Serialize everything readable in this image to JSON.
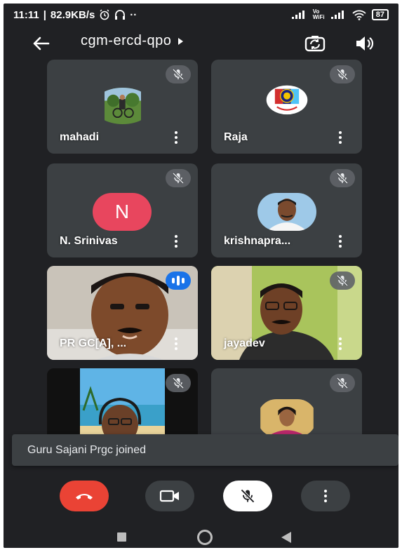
{
  "status_bar": {
    "time": "11:11",
    "speed": "82.9KB/s",
    "network_label": "Vo WiFi",
    "battery": "87"
  },
  "header": {
    "meeting_code": "cgm-ercd-qpo"
  },
  "participants": [
    {
      "name": "mahadi",
      "muted": true,
      "speaking": false
    },
    {
      "name": "Raja",
      "muted": true,
      "speaking": false
    },
    {
      "name": "N. Srinivas",
      "initial": "N",
      "avatar_color": "#e8465e",
      "muted": true,
      "speaking": false
    },
    {
      "name": "krishnapra...",
      "muted": true,
      "speaking": false
    },
    {
      "name": "PR GC[A], ...",
      "muted": false,
      "speaking": true
    },
    {
      "name": "jayadev",
      "muted": true,
      "speaking": false
    },
    {
      "name": "",
      "muted": true,
      "speaking": false
    },
    {
      "name": "",
      "muted": true,
      "speaking": false
    }
  ],
  "toast": {
    "message": "Guru Sajani Prgc joined"
  },
  "controls": {
    "end_call_color": "#ea4335"
  },
  "icons": {
    "back": "arrow-left-icon",
    "camera_switch": "camera-switch-icon",
    "speaker": "speaker-icon",
    "mute": "mic-off-icon",
    "more": "more-vertical-icon",
    "end_call": "phone-hangup-icon",
    "video": "videocam-icon"
  }
}
